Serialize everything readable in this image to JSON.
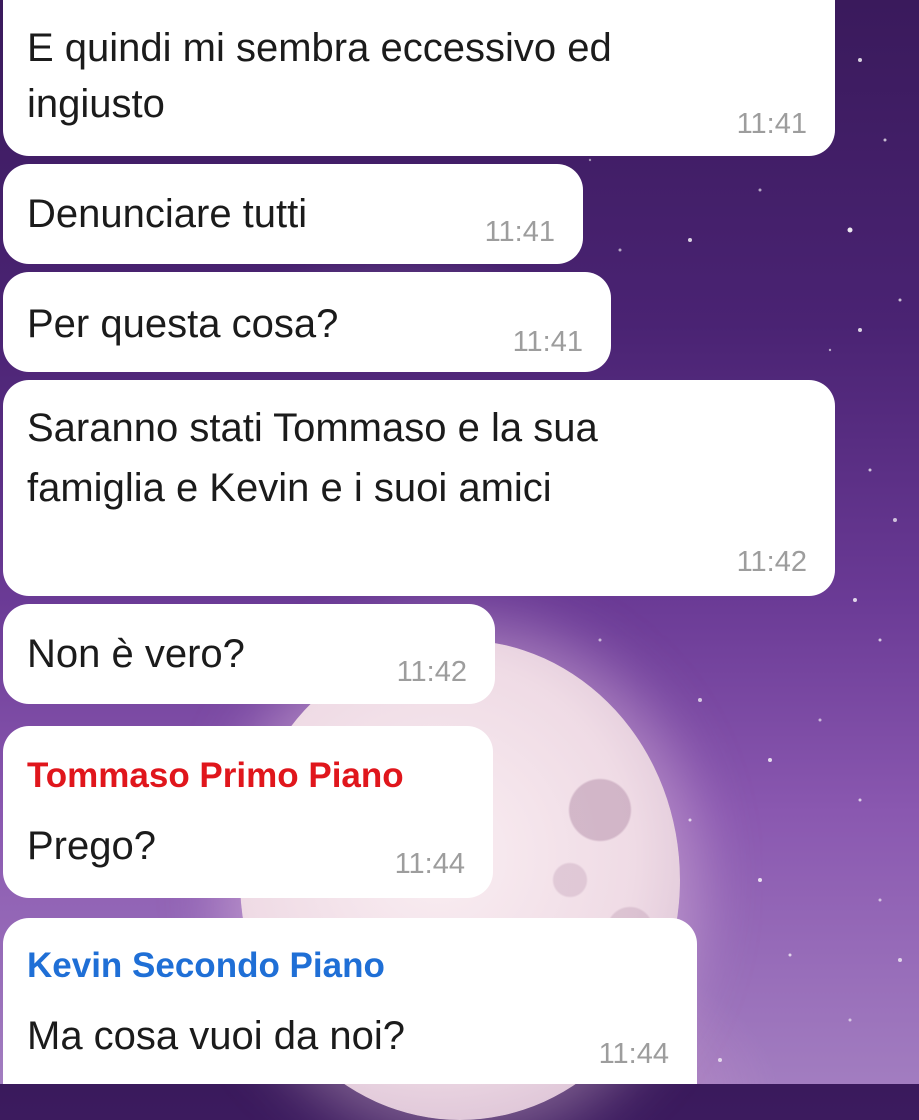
{
  "background": {
    "theme": "purple-night-sky-with-moon",
    "colors": {
      "sky_top": "#3a1a5c",
      "sky_bottom": "#a27dc0",
      "moon": "#efdbe5"
    }
  },
  "messages": [
    {
      "lines": [
        "E quindi mi sembra eccessivo ed",
        "ingiusto"
      ],
      "time": "11:41"
    },
    {
      "lines": [
        "Denunciare tutti"
      ],
      "time": "11:41"
    },
    {
      "lines": [
        "Per questa cosa?"
      ],
      "time": "11:41"
    },
    {
      "lines": [
        "Saranno stati Tommaso e la sua",
        "famiglia e Kevin e i suoi amici"
      ],
      "time": "11:42"
    },
    {
      "lines": [
        "Non è vero?"
      ],
      "time": "11:42"
    },
    {
      "sender": "Tommaso Primo Piano",
      "sender_color": "#e0161c",
      "lines": [
        "Prego?"
      ],
      "time": "11:44"
    },
    {
      "sender": "Kevin Secondo Piano",
      "sender_color": "#1f6fd6",
      "lines": [
        "Ma cosa vuoi da noi?"
      ],
      "time": "11:44"
    }
  ]
}
